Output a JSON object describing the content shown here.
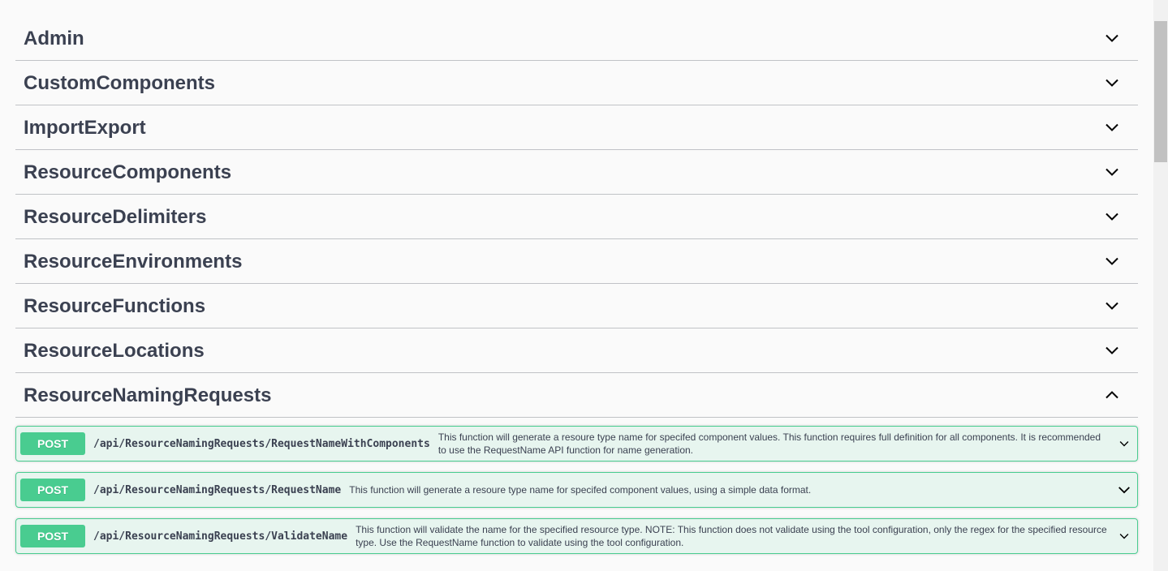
{
  "tags": [
    {
      "name": "Admin",
      "expanded": false
    },
    {
      "name": "CustomComponents",
      "expanded": false
    },
    {
      "name": "ImportExport",
      "expanded": false
    },
    {
      "name": "ResourceComponents",
      "expanded": false
    },
    {
      "name": "ResourceDelimiters",
      "expanded": false
    },
    {
      "name": "ResourceEnvironments",
      "expanded": false
    },
    {
      "name": "ResourceFunctions",
      "expanded": false
    },
    {
      "name": "ResourceLocations",
      "expanded": false
    },
    {
      "name": "ResourceNamingRequests",
      "expanded": true
    }
  ],
  "operations": [
    {
      "method": "POST",
      "path": "/api/ResourceNamingRequests/RequestNameWithComponents",
      "description": "This function will generate a resoure type name for specifed component values. This function requires full definition for all components. It is recommended to use the RequestName API function for name generation."
    },
    {
      "method": "POST",
      "path": "/api/ResourceNamingRequests/RequestName",
      "description": "This function will generate a resoure type name for specifed component values, using a simple data format."
    },
    {
      "method": "POST",
      "path": "/api/ResourceNamingRequests/ValidateName",
      "description": "This function will validate the name for the specified resource type. NOTE: This function does not validate using the tool configuration, only the regex for the specified resource type. Use the RequestName function to validate using the tool configuration."
    }
  ],
  "icons": {
    "collapsed": "chevron-down-icon",
    "expanded": "chevron-up-icon"
  },
  "colors": {
    "post": "#49cc90",
    "text": "#3b4151",
    "background": "#fafafa"
  }
}
